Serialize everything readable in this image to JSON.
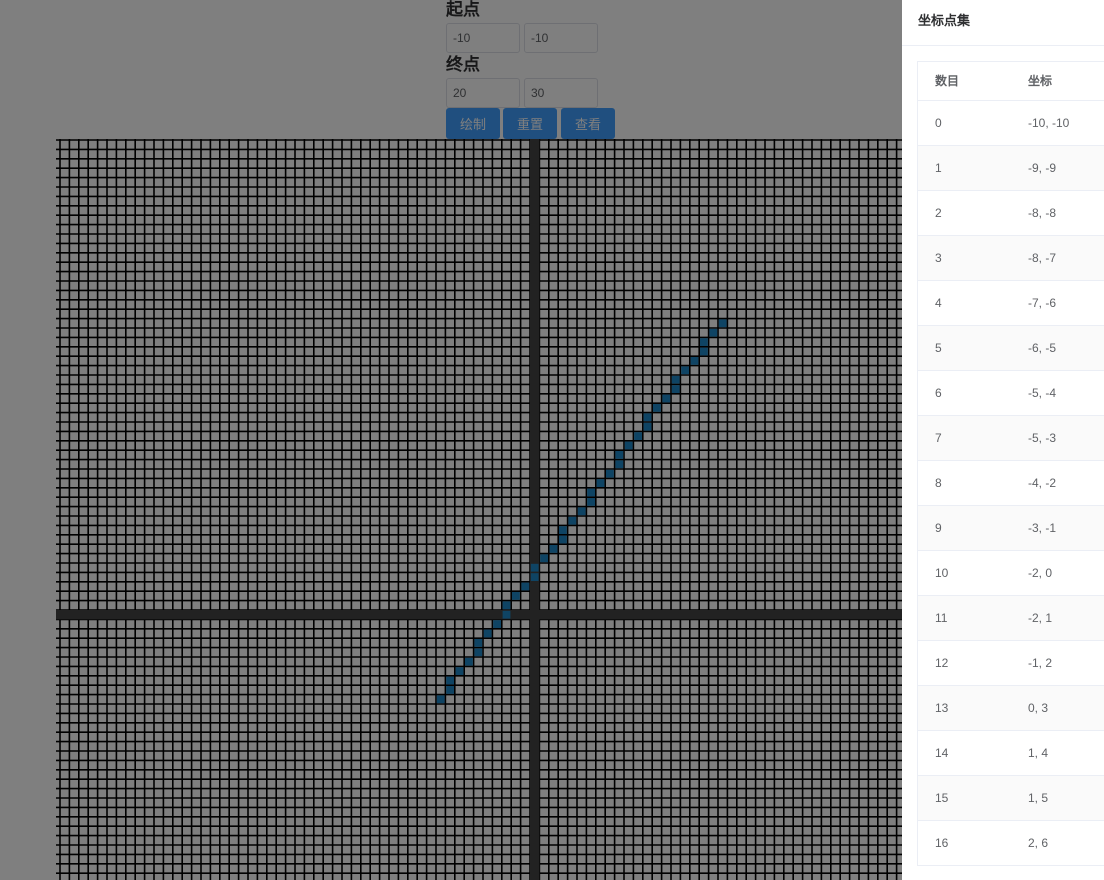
{
  "controls": {
    "start_label": "起点",
    "start_x": "-10",
    "start_y": "-10",
    "end_label": "终点",
    "end_x": "20",
    "end_y": "30",
    "draw_button": "绘制",
    "reset_button": "重置",
    "view_button": "查看"
  },
  "canvas": {
    "origin_col": 50,
    "origin_row": 50,
    "cols": 90,
    "rows": 80,
    "start_point": [
      -10,
      -10
    ],
    "end_point": [
      20,
      30
    ]
  },
  "colors": {
    "button": "#409eff",
    "grid_line": "#000000",
    "grid_cell": "#ffffff",
    "axis": "#444444",
    "pixel": "#1e88c8"
  },
  "drawer": {
    "title": "坐标点集",
    "col_index": "数目",
    "col_coord": "坐标",
    "rows": [
      {
        "index": "0",
        "coord": "-10, -10"
      },
      {
        "index": "1",
        "coord": "-9, -9"
      },
      {
        "index": "2",
        "coord": "-8, -8"
      },
      {
        "index": "3",
        "coord": "-8, -7"
      },
      {
        "index": "4",
        "coord": "-7, -6"
      },
      {
        "index": "5",
        "coord": "-6, -5"
      },
      {
        "index": "6",
        "coord": "-5, -4"
      },
      {
        "index": "7",
        "coord": "-5, -3"
      },
      {
        "index": "8",
        "coord": "-4, -2"
      },
      {
        "index": "9",
        "coord": "-3, -1"
      },
      {
        "index": "10",
        "coord": "-2, 0"
      },
      {
        "index": "11",
        "coord": "-2, 1"
      },
      {
        "index": "12",
        "coord": "-1, 2"
      },
      {
        "index": "13",
        "coord": "0, 3"
      },
      {
        "index": "14",
        "coord": "1, 4"
      },
      {
        "index": "15",
        "coord": "1, 5"
      },
      {
        "index": "16",
        "coord": "2, 6"
      }
    ]
  }
}
